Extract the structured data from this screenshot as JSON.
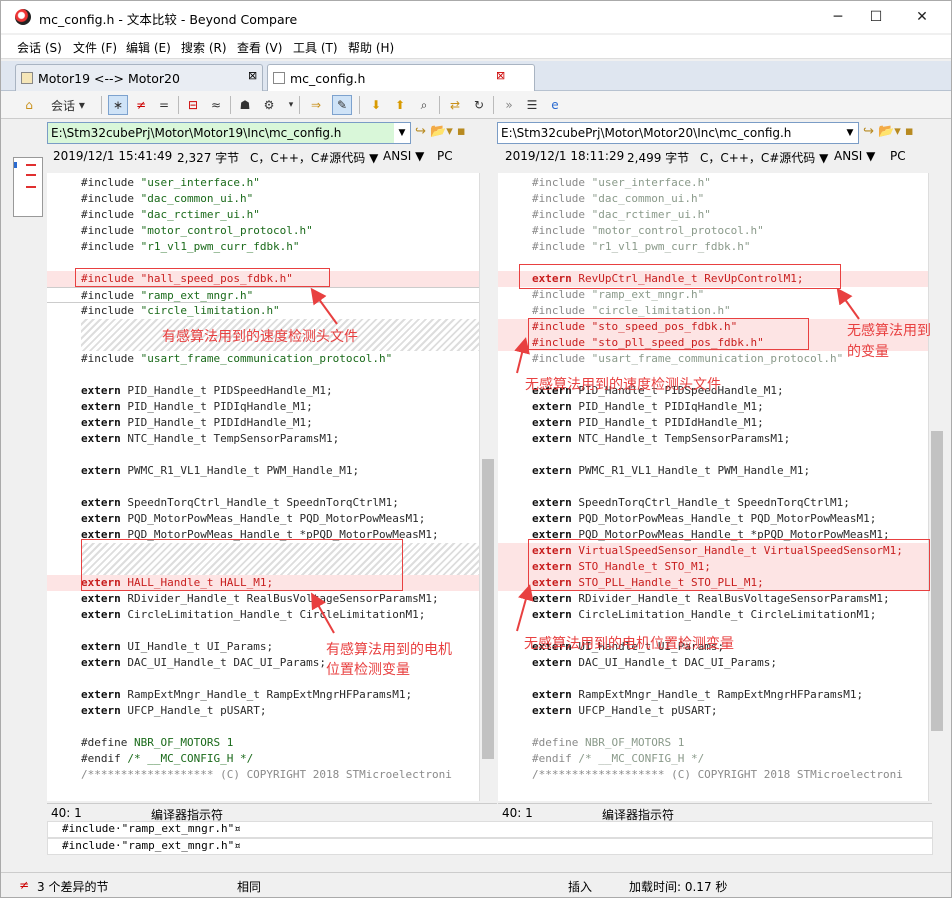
{
  "window": {
    "title": "mc_config.h - 文本比较 - Beyond Compare",
    "minimize": "─",
    "maximize": "☐",
    "close": "✕"
  },
  "menu": [
    "会话 (S)",
    "文件 (F)",
    "编辑 (E)",
    "搜索 (R)",
    "查看 (V)",
    "工具 (T)",
    "帮助 (H)"
  ],
  "tabs": [
    {
      "label": "Motor19 <--> Motor20",
      "close": "⊠"
    },
    {
      "label": "mc_config.h",
      "close": "⊠"
    }
  ],
  "toolbar": {
    "session_label": "会话"
  },
  "left": {
    "path": "E:\\Stm32cubePrj\\Motor\\Motor19\\Inc\\mc_config.h",
    "date": "2019/12/1 15:41:49",
    "size": "2,327 字节",
    "format": "C，C++，C#源代码 ▼",
    "encoding": "ANSI ▼",
    "lineend": "PC",
    "position": "40: 1",
    "mode": "编译器指示符"
  },
  "right": {
    "path": "E:\\Stm32cubePrj\\Motor\\Motor20\\Inc\\mc_config.h",
    "date": "2019/12/1 18:11:29",
    "size": "2,499 字节",
    "format": "C，C++，C#源代码 ▼",
    "encoding": "ANSI ▼",
    "lineend": "PC",
    "position": "40: 1",
    "mode": "编译器指示符"
  },
  "left_lines": [
    [
      "n",
      "#include ",
      "\"user_interface.h\""
    ],
    [
      "n",
      "#include ",
      "\"dac_common_ui.h\""
    ],
    [
      "n",
      "#include ",
      "\"dac_rctimer_ui.h\""
    ],
    [
      "n",
      "#include ",
      "\"motor_control_protocol.h\""
    ],
    [
      "n",
      "#include ",
      "\"r1_vl1_pwm_curr_fdbk.h\""
    ],
    [
      "e",
      "",
      ""
    ],
    [
      "dR",
      "#include ",
      "\"hall_speed_pos_fdbk.h\""
    ],
    [
      "c",
      "#include ",
      "\"ramp_ext_mngr.h\""
    ],
    [
      "n",
      "#include ",
      "\"circle_limitation.h\""
    ],
    [
      "h",
      "",
      ""
    ],
    [
      "h",
      "",
      ""
    ],
    [
      "n",
      "#include ",
      "\"usart_frame_communication_protocol.h\""
    ],
    [
      "e",
      "",
      ""
    ],
    [
      "k",
      "extern",
      " PID_Handle_t PIDSpeedHandle_M1;"
    ],
    [
      "k",
      "extern",
      " PID_Handle_t PIDIqHandle_M1;"
    ],
    [
      "k",
      "extern",
      " PID_Handle_t PIDIdHandle_M1;"
    ],
    [
      "k",
      "extern",
      " NTC_Handle_t TempSensorParamsM1;"
    ],
    [
      "e",
      "",
      ""
    ],
    [
      "k",
      "extern",
      " PWMC_R1_VL1_Handle_t PWM_Handle_M1;"
    ],
    [
      "e",
      "",
      ""
    ],
    [
      "k",
      "extern",
      " SpeednTorqCtrl_Handle_t SpeednTorqCtrlM1;"
    ],
    [
      "k",
      "extern",
      " PQD_MotorPowMeas_Handle_t PQD_MotorPowMeasM1;"
    ],
    [
      "k",
      "extern",
      " PQD_MotorPowMeas_Handle_t *pPQD_MotorPowMeasM1;"
    ],
    [
      "h",
      "",
      ""
    ],
    [
      "h",
      "",
      ""
    ],
    [
      "kR",
      "extern",
      " HALL_Handle_t HALL_M1;"
    ],
    [
      "k",
      "extern",
      " RDivider_Handle_t RealBusVoltageSensorParamsM1;"
    ],
    [
      "k",
      "extern",
      " CircleLimitation_Handle_t CircleLimitationM1;"
    ],
    [
      "e",
      "",
      ""
    ],
    [
      "k",
      "extern",
      " UI_Handle_t UI_Params;"
    ],
    [
      "k",
      "extern",
      " DAC_UI_Handle_t DAC_UI_Params;"
    ],
    [
      "e",
      "",
      ""
    ],
    [
      "k",
      "extern",
      " RampExtMngr_Handle_t RampExtMngrHFParamsM1;"
    ],
    [
      "k",
      "extern",
      " UFCP_Handle_t pUSART;"
    ],
    [
      "e",
      "",
      ""
    ],
    [
      "n",
      "#define ",
      "NBR_OF_MOTORS 1"
    ],
    [
      "n",
      "#endif ",
      "/* __MC_CONFIG_H */"
    ],
    [
      "g",
      "/******************* (C) COPYRIGHT 2018 STMicroelectroni",
      ""
    ]
  ],
  "right_lines": [
    [
      "g",
      "#include ",
      "\"user_interface.h\""
    ],
    [
      "g",
      "#include ",
      "\"dac_common_ui.h\""
    ],
    [
      "g",
      "#include ",
      "\"dac_rctimer_ui.h\""
    ],
    [
      "g",
      "#include ",
      "\"motor_control_protocol.h\""
    ],
    [
      "g",
      "#include ",
      "\"r1_vl1_pwm_curr_fdbk.h\""
    ],
    [
      "e",
      "",
      ""
    ],
    [
      "kR",
      "extern",
      " RevUpCtrl_Handle_t RevUpControlM1;"
    ],
    [
      "g",
      "#include ",
      "\"ramp_ext_mngr.h\""
    ],
    [
      "g",
      "#include ",
      "\"circle_limitation.h\""
    ],
    [
      "dR",
      "#include ",
      "\"sto_speed_pos_fdbk.h\""
    ],
    [
      "dR",
      "#include ",
      "\"sto_pll_speed_pos_fdbk.h\""
    ],
    [
      "g",
      "#include ",
      "\"usart_frame_communication_protocol.h\""
    ],
    [
      "e",
      "",
      ""
    ],
    [
      "k",
      "extern",
      " PID_Handle_t PIDSpeedHandle_M1;"
    ],
    [
      "k",
      "extern",
      " PID_Handle_t PIDIqHandle_M1;"
    ],
    [
      "k",
      "extern",
      " PID_Handle_t PIDIdHandle_M1;"
    ],
    [
      "k",
      "extern",
      " NTC_Handle_t TempSensorParamsM1;"
    ],
    [
      "e",
      "",
      ""
    ],
    [
      "k",
      "extern",
      " PWMC_R1_VL1_Handle_t PWM_Handle_M1;"
    ],
    [
      "e",
      "",
      ""
    ],
    [
      "k",
      "extern",
      " SpeednTorqCtrl_Handle_t SpeednTorqCtrlM1;"
    ],
    [
      "k",
      "extern",
      " PQD_MotorPowMeas_Handle_t PQD_MotorPowMeasM1;"
    ],
    [
      "k",
      "extern",
      " PQD_MotorPowMeas_Handle_t *pPQD_MotorPowMeasM1;"
    ],
    [
      "kR",
      "extern",
      " VirtualSpeedSensor_Handle_t VirtualSpeedSensorM1;"
    ],
    [
      "kR",
      "extern",
      " STO_Handle_t STO_M1;"
    ],
    [
      "kR",
      "extern",
      " STO_PLL_Handle_t STO_PLL_M1;"
    ],
    [
      "k",
      "extern",
      " RDivider_Handle_t RealBusVoltageSensorParamsM1;"
    ],
    [
      "k",
      "extern",
      " CircleLimitation_Handle_t CircleLimitationM1;"
    ],
    [
      "e",
      "",
      ""
    ],
    [
      "k",
      "extern",
      " UI_Handle_t UI_Params;"
    ],
    [
      "k",
      "extern",
      " DAC_UI_Handle_t DAC_UI_Params;"
    ],
    [
      "e",
      "",
      ""
    ],
    [
      "k",
      "extern",
      " RampExtMngr_Handle_t RampExtMngrHFParamsM1;"
    ],
    [
      "k",
      "extern",
      " UFCP_Handle_t pUSART;"
    ],
    [
      "e",
      "",
      ""
    ],
    [
      "g",
      "#define ",
      "NBR_OF_MOTORS 1"
    ],
    [
      "g",
      "#endif ",
      "/* __MC_CONFIG_H */"
    ],
    [
      "g",
      "/******************* (C) COPYRIGHT 2018 STMicroelectroni",
      ""
    ]
  ],
  "annotations": {
    "left_top": "有感算法用到的速度检测头文件",
    "left_bottom_1": "有感算法用到的电机",
    "left_bottom_2": "位置检测变量",
    "right_top_1": "无感算法用到",
    "right_top_2": "的变量",
    "right_mid": "无感算法用到的速度检测头文件",
    "right_bottom": "无感算法用到的电机位置检测变量"
  },
  "compare_lines": {
    "line1": "#include·\"ramp_ext_mngr.h\"¤",
    "line2": "#include·\"ramp_ext_mngr.h\"¤"
  },
  "statusbar": {
    "diff_count": "3 个差异的节",
    "same": "相同",
    "insert": "插入",
    "load_time": "加载时间:  0.17 秒"
  }
}
